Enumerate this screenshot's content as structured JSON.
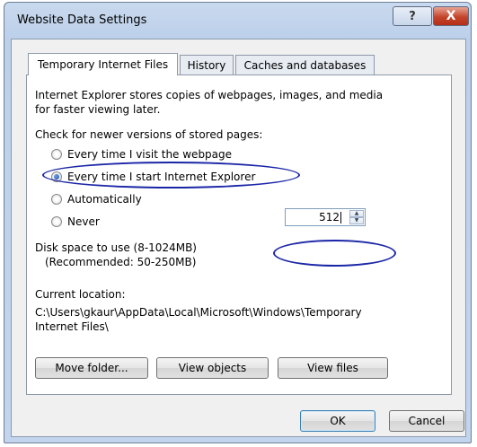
{
  "window": {
    "title": "Website Data Settings",
    "help_label": "?",
    "close_label": "X"
  },
  "tabs": [
    {
      "label": "Temporary Internet Files",
      "active": true
    },
    {
      "label": "History",
      "active": false
    },
    {
      "label": "Caches and databases",
      "active": false
    }
  ],
  "panel": {
    "description_line1": "Internet Explorer stores copies of webpages, images, and media",
    "description_line2": "for faster viewing later.",
    "check_label": "Check for newer versions of stored pages:",
    "options": [
      {
        "label": "Every time I visit the webpage",
        "selected": false
      },
      {
        "label": "Every time I start Internet Explorer",
        "selected": true
      },
      {
        "label": "Automatically",
        "selected": false
      },
      {
        "label": "Never",
        "selected": false
      }
    ],
    "disk_label_line1": "Disk space to use (8-1024MB)",
    "disk_label_line2": "(Recommended: 50-250MB)",
    "disk_value": "512",
    "current_location_label": "Current location:",
    "path_line1": "C:\\Users\\gkaur\\AppData\\Local\\Microsoft\\Windows\\Temporary",
    "path_line2": "Internet Files\\",
    "buttons": {
      "move_folder": "Move folder...",
      "view_objects": "View objects",
      "view_files": "View files"
    }
  },
  "footer": {
    "ok": "OK",
    "cancel": "Cancel"
  },
  "colors": {
    "annotation_ellipse": "#1b26a6",
    "selected_radio": "#1d4d9e"
  }
}
